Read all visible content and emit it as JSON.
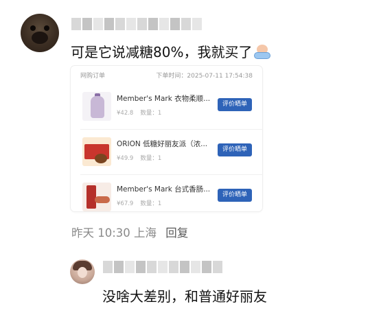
{
  "comments": [
    {
      "text": "可是它说减糖80%，我就买了",
      "emoji": "crying-emoji",
      "meta": {
        "time": "昨天 10:30",
        "location": "上海",
        "reply_label": "回复"
      }
    },
    {
      "text": "没啥大差别，和普通好丽友"
    }
  ],
  "order_card": {
    "title": "网购订单",
    "time_label": "下单时间：2025-07-11 17:54:38",
    "items": [
      {
        "name": "Member's Mark 衣物柔顺...",
        "price": "¥42.8",
        "qty": "数量：1",
        "button": "评价晒单",
        "icon": "fabric-softener-bottle-icon"
      },
      {
        "name": "ORION 低糖好丽友派（浓...",
        "price": "¥49.9",
        "qty": "数量：1",
        "button": "评价晒单",
        "icon": "orion-chocopie-box-icon"
      },
      {
        "name": "Member's Mark 台式香肠...",
        "price": "¥67.9",
        "qty": "数量：1",
        "button": "评价晒单",
        "icon": "sausage-pack-icon"
      }
    ]
  },
  "colors": {
    "button_blue": "#2e63b8",
    "meta_gray": "#8a8a8a"
  }
}
